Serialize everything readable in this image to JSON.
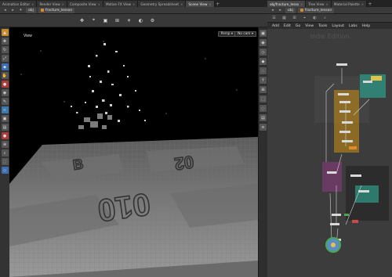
{
  "left_pane": {
    "tabs": [
      {
        "label": "Animation Editor"
      },
      {
        "label": "Render View"
      },
      {
        "label": "Composite View"
      },
      {
        "label": "Motion FX View"
      },
      {
        "label": "Geometry Spreadsheet"
      },
      {
        "label": "Scene View",
        "active": true
      }
    ],
    "path": {
      "root": "obj",
      "node": "fracture_lesson"
    },
    "viewport": {
      "label": "View",
      "persp_label": "Persp ▾",
      "cam_label": "No cam ▾",
      "floor_text": [
        "B",
        "02",
        "010"
      ]
    }
  },
  "right_pane": {
    "tabs": [
      {
        "label": "obj/fracture_lesso",
        "active": true
      },
      {
        "label": "Tree View"
      },
      {
        "label": "Material Palette"
      }
    ],
    "path": {
      "root": "obj",
      "node": "fracture_lesson"
    },
    "menu": [
      "Add",
      "Edit",
      "Go",
      "View",
      "Tools",
      "Layout",
      "Labs",
      "Help"
    ],
    "watermark": "Indie Edition"
  },
  "colors": {
    "accent_orange": "#d98a2b",
    "node_teal": "#2e8d7c",
    "node_purple": "#7a3b6f",
    "node_gold": "#a57a1f",
    "node_green": "#4aa84a"
  }
}
